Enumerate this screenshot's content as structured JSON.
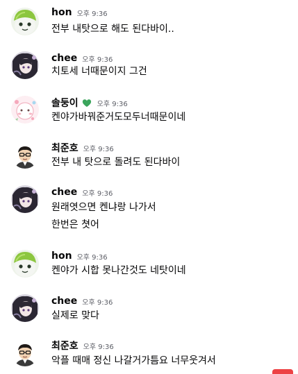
{
  "messages": [
    {
      "author": "hon",
      "time": "오후 9:36",
      "avatar": "green-cap-avatar",
      "lines": [
        "전부 내탓으로 해도 된다바이.."
      ]
    },
    {
      "author": "chee",
      "time": "오후 9:36",
      "avatar": "dark-anime-avatar",
      "lines": [
        "치토세 너때문이지 그건"
      ]
    },
    {
      "author": "솔둥이",
      "time": "오후 9:36",
      "avatar": "pink-character-avatar",
      "badge": "green-heart-badge-icon",
      "lines": [
        "켄야가바꿔준거도모두너때문이네"
      ]
    },
    {
      "author": "최준호",
      "time": "오후 9:36",
      "avatar": "glasses-man-avatar",
      "lines": [
        "전부 내 탓으로 돌려도 된다바이"
      ]
    },
    {
      "author": "chee",
      "time": "오후 9:36",
      "avatar": "dark-anime-avatar",
      "lines": [
        "원래엿으면 켄냐랑 나가서",
        "한번은 쳣어"
      ]
    },
    {
      "author": "hon",
      "time": "오후 9:36",
      "avatar": "green-cap-avatar",
      "lines": [
        "켄야가 시합 못나간것도 네탓이네"
      ]
    },
    {
      "author": "chee",
      "time": "오후 9:36",
      "avatar": "dark-anime-avatar",
      "lines": [
        "실제로 맞다"
      ]
    },
    {
      "author": "최준호",
      "time": "오후 9:36",
      "avatar": "glasses-man-avatar",
      "lines": [
        "악플 때매 정신 나갈거가틈요 너무웃겨서"
      ]
    }
  ],
  "colors": {
    "background": "#ffffff",
    "name": "#060607",
    "time": "#5c5e66",
    "badge": "#3ba55c",
    "corner_tab": "#ed4245"
  }
}
